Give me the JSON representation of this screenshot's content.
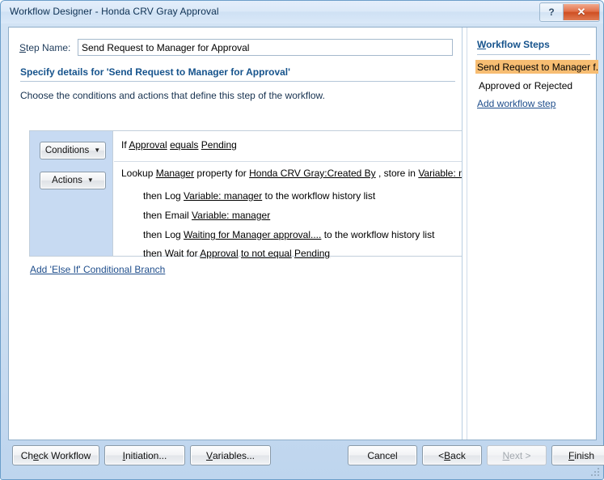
{
  "window": {
    "title": "Workflow Designer - Honda CRV Gray Approval",
    "help_button": "?",
    "close_button": "✕"
  },
  "step": {
    "label_prefix": "S",
    "label_rest": "tep Name:",
    "value": "Send Request to Manager for Approval"
  },
  "details": {
    "heading": "Specify details for 'Send Request to Manager for Approval'",
    "subtext": "Choose the conditions and actions that define this step of the workflow."
  },
  "buttons": {
    "conditions": "Conditions",
    "actions": "Actions",
    "caret": "▼"
  },
  "rules": {
    "condition": {
      "prefix": "If ",
      "field": "Approval",
      "mid": " ",
      "operator": "equals",
      "mid2": " ",
      "value": "Pending"
    },
    "actions": [
      {
        "t0": "Lookup ",
        "l0": "Manager",
        "t1": " property for ",
        "l1": "Honda CRV Gray:Created By",
        "t2": " , store in ",
        "l2": "Variable: manager",
        "t3": ""
      },
      {
        "t0": "then Log ",
        "l0": "Variable: manager",
        "t1": "  to the workflow history list",
        "l1": "",
        "t2": "",
        "l2": "",
        "t3": ""
      },
      {
        "t0": "then Email ",
        "l0": "Variable: manager",
        "t1": "",
        "l1": "",
        "t2": "",
        "l2": "",
        "t3": ""
      },
      {
        "t0": "then Log ",
        "l0": "Waiting for Manager approval....",
        "t1": "  to the workflow history list",
        "l1": "",
        "t2": "",
        "l2": "",
        "t3": ""
      },
      {
        "t0": "then Wait for ",
        "l0": "Approval",
        "t1": " ",
        "l1": "to not equal",
        "t2": " ",
        "l2": "Pending",
        "t3": ""
      }
    ]
  },
  "else_branch_link": "Add 'Else If' Conditional Branch",
  "scrollbar": {
    "left_arrow": "◀",
    "right_arrow": "▶",
    "grip": "∣∣∣"
  },
  "sidebar": {
    "title_accel": "W",
    "title_rest": "orkflow Steps",
    "items": [
      {
        "label": "Send Request to Manager f...",
        "selected": true
      },
      {
        "label": "Approved or Rejected",
        "selected": false
      }
    ],
    "add_step_link": "Add workflow step"
  },
  "footer": {
    "check_workflow": {
      "pre": "Ch",
      "accel": "e",
      "post": "ck Workflow"
    },
    "initiation": {
      "pre": "",
      "accel": "I",
      "post": "nitiation..."
    },
    "variables": {
      "pre": "",
      "accel": "V",
      "post": "ariables..."
    },
    "cancel": {
      "pre": "Cancel",
      "accel": "",
      "post": ""
    },
    "back": {
      "pre": "< ",
      "accel": "B",
      "post": "ack"
    },
    "next": {
      "pre": "",
      "accel": "N",
      "post": "ext >"
    },
    "finish": {
      "pre": "",
      "accel": "F",
      "post": "inish"
    }
  },
  "colors": {
    "accent_heading": "#16538c",
    "selection_orange": "#f7bd72",
    "left_panel_blue": "#c7daf2",
    "link_blue": "#1f4e8c",
    "close_red": "#cf4f23"
  }
}
